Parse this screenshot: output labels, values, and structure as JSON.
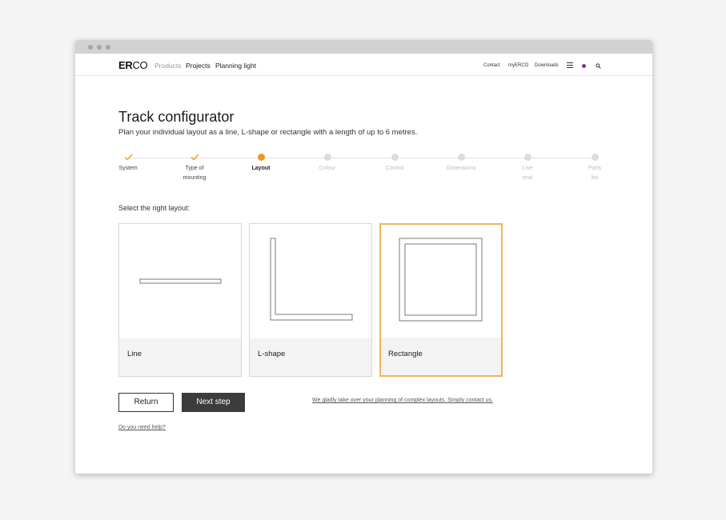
{
  "window": {
    "controls": [
      "close",
      "minimize",
      "maximize"
    ]
  },
  "header": {
    "logo_bold": "ER",
    "logo_thin": "CO",
    "nav_left": {
      "products": "Products",
      "projects": "Projects",
      "planning": "Planning light"
    },
    "nav_right": {
      "contact": "Contact",
      "myerco": "myERCO",
      "downloads": "Downloads"
    },
    "icons": [
      "menu-icon",
      "language-flag-icon",
      "search-icon"
    ]
  },
  "page": {
    "title": "Track configurator",
    "subtitle": "Plan your individual layout as a line, L-shape or rectangle with a length of up to 6 metres."
  },
  "steps": [
    {
      "label": "System",
      "state": "done"
    },
    {
      "label": "Type of mounting",
      "state": "done"
    },
    {
      "label": "Layout",
      "state": "active"
    },
    {
      "label": "Colour",
      "state": "todo"
    },
    {
      "label": "Control",
      "state": "todo"
    },
    {
      "label": "Dimensions",
      "state": "todo"
    },
    {
      "label": "Live end",
      "state": "todo"
    },
    {
      "label": "Parts list",
      "state": "todo"
    }
  ],
  "layout_section": {
    "label": "Select the right layout:",
    "options": [
      {
        "name": "Line",
        "selected": false
      },
      {
        "name": "L-shape",
        "selected": false
      },
      {
        "name": "Rectangle",
        "selected": true
      }
    ]
  },
  "actions": {
    "return": "Return",
    "next": "Next step",
    "contact_link": "We gladly take over your planning of complex layouts. Simply contact us.",
    "help_link": "Do you need help?"
  },
  "colors": {
    "accent": "#ee9a1f",
    "selected_border": "#f0b45c",
    "primary_button": "#3c3c3c"
  }
}
